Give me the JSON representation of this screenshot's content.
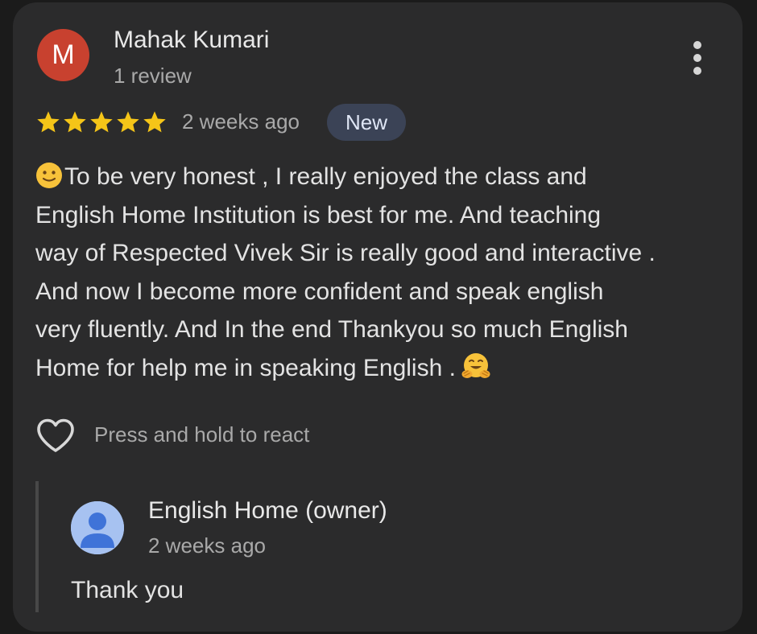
{
  "reviewer": {
    "initial": "M",
    "name": "Mahak Kumari",
    "review_count": "1 review",
    "avatar_color": "#c8412f"
  },
  "review": {
    "rating": 5,
    "max_rating": 5,
    "star_color": "#f5c518",
    "time_ago": "2 weeks ago",
    "badge": "New",
    "lines": [
      "To be very honest , I really enjoyed the class and",
      "English Home Institution is best for me. And teaching",
      "way of Respected Vivek Sir is really good and interactive .",
      "And now I become more confident and speak english",
      "very fluently. And In the end Thankyou so much English",
      "Home for help me in speaking English ."
    ],
    "leading_emoji": "slightly-smiling-face-icon",
    "trailing_emoji": "hugging-face-icon"
  },
  "reaction": {
    "icon": "heart-outline-icon",
    "hint": "Press and hold to react"
  },
  "menu": {
    "icon": "more-vertical-icon"
  },
  "owner_reply": {
    "name": "English Home (owner)",
    "time_ago": "2 weeks ago",
    "text": "Thank you",
    "avatar_icon": "default-person-avatar-icon",
    "avatar_color": "#a7c2f1"
  },
  "colors": {
    "background": "#1b1b1b",
    "card": "#2b2b2c",
    "primary_text": "#e3e3e3",
    "secondary_text": "#a9a9a9",
    "badge_bg": "#3b4356"
  }
}
